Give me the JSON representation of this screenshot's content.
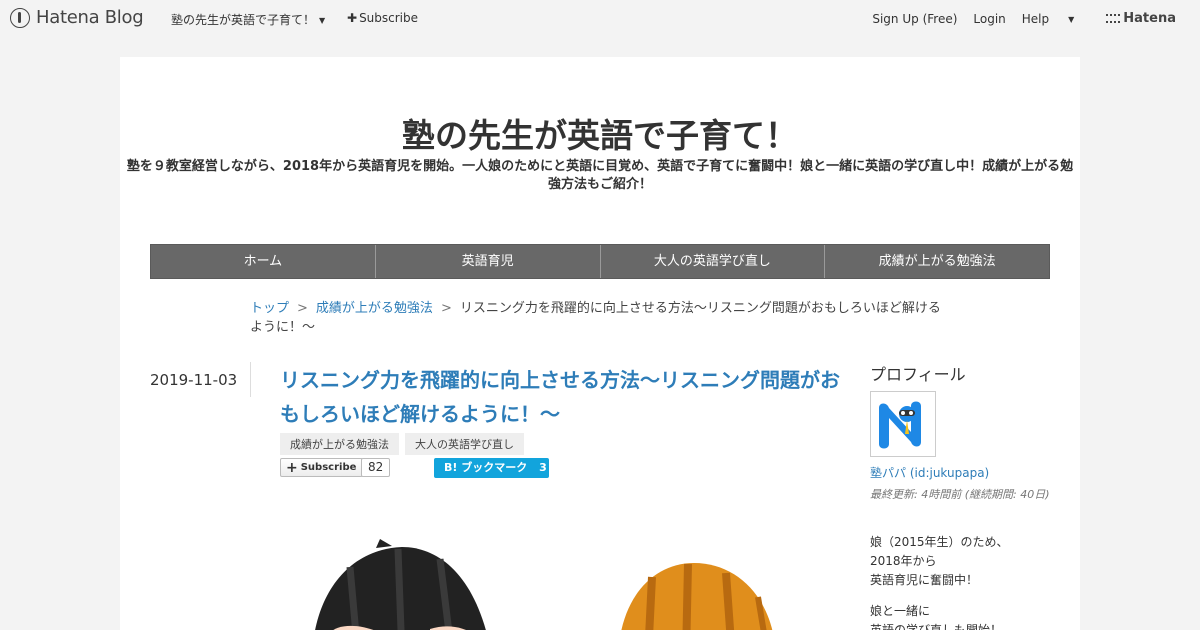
{
  "topbar": {
    "logo_text": "Hatena Blog",
    "blog_switch": "塾の先生が英語で子育て！",
    "subscribe": "Subscribe",
    "signup": "Sign Up (Free)",
    "login": "Login",
    "help": "Help",
    "brand": "Hatena"
  },
  "blog": {
    "title": "塾の先生が英語で子育て！",
    "description": "塾を９教室経営しながら、2018年から英語育児を開始。一人娘のためにと英語に目覚め、英語で子育てに奮闘中！娘と一緒に英語の学び直し中！成績が上がる勉強方法もご紹介！"
  },
  "nav": [
    "ホーム",
    "英語育児",
    "大人の英語学び直し",
    "成績が上がる勉強法"
  ],
  "breadcrumb": {
    "top": "トップ",
    "category": "成績が上がる勉強法",
    "current": "リスニング力を飛躍的に向上させる方法～リスニング問題がおもしろいほど解けるように！～",
    "sep": ">"
  },
  "entry": {
    "date": "2019-11-03",
    "title": "リスニング力を飛躍的に向上させる方法～リスニング問題がおもしろいほど解けるように！～",
    "categories": [
      "成績が上がる勉強法",
      "大人の英語学び直し"
    ],
    "subscribe_label": "Subscribe",
    "subscribe_count": "82",
    "bookmark_label": "ブックマーク",
    "bookmark_count": "3"
  },
  "sidebar": {
    "heading": "プロフィール",
    "name": "塾パパ (id:jukupapa)",
    "updated": "最終更新: 4時間前 (継続期間: 40日)",
    "bio_lines": [
      "娘（2015年生）のため、",
      "2018年から",
      "英語育児に奮闘中！",
      "",
      "娘と一緒に",
      "英語の学び直しも開始！"
    ]
  },
  "colors": {
    "link": "#2e7db8",
    "nav_bg": "#686868",
    "bookmark_blue": "#12a4dc",
    "page_bg": "#f3f3f3"
  }
}
